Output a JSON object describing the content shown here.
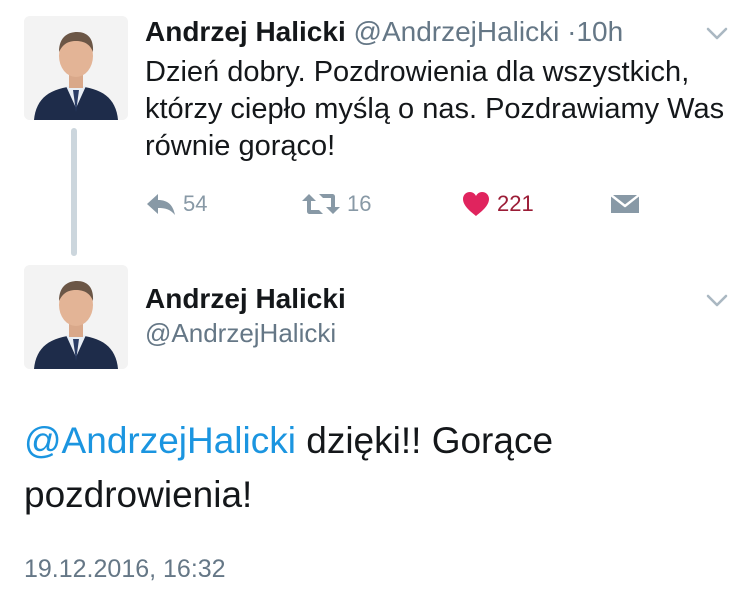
{
  "colors": {
    "text": "#14171a",
    "secondary": "#657786",
    "mention": "#1b95e0",
    "like": "#e0245e",
    "thread_line": "#ccd6dd"
  },
  "tweet1": {
    "display_name": "Andrzej Halicki",
    "handle": "@AndrzejHalicki",
    "separator": "·",
    "time": "10h",
    "text": "Dzień dobry. Pozdrowienia dla wszystkich, którzy ciepło myślą o nas. Pozdrawiamy Was równie gorąco!",
    "reply_count": "54",
    "retweet_count": "16",
    "like_count": "221",
    "icons": [
      "reply-icon",
      "retweet-icon",
      "heart-icon",
      "direct-message-icon",
      "chevron-down-icon"
    ]
  },
  "tweet2": {
    "display_name": "Andrzej Halicki",
    "handle": "@AndrzejHalicki",
    "mention": "@AndrzejHalicki",
    "text": " dzięki!! Gorące pozdrowienia!",
    "timestamp": "19.12.2016, 16:32",
    "icons": [
      "chevron-down-icon"
    ]
  }
}
